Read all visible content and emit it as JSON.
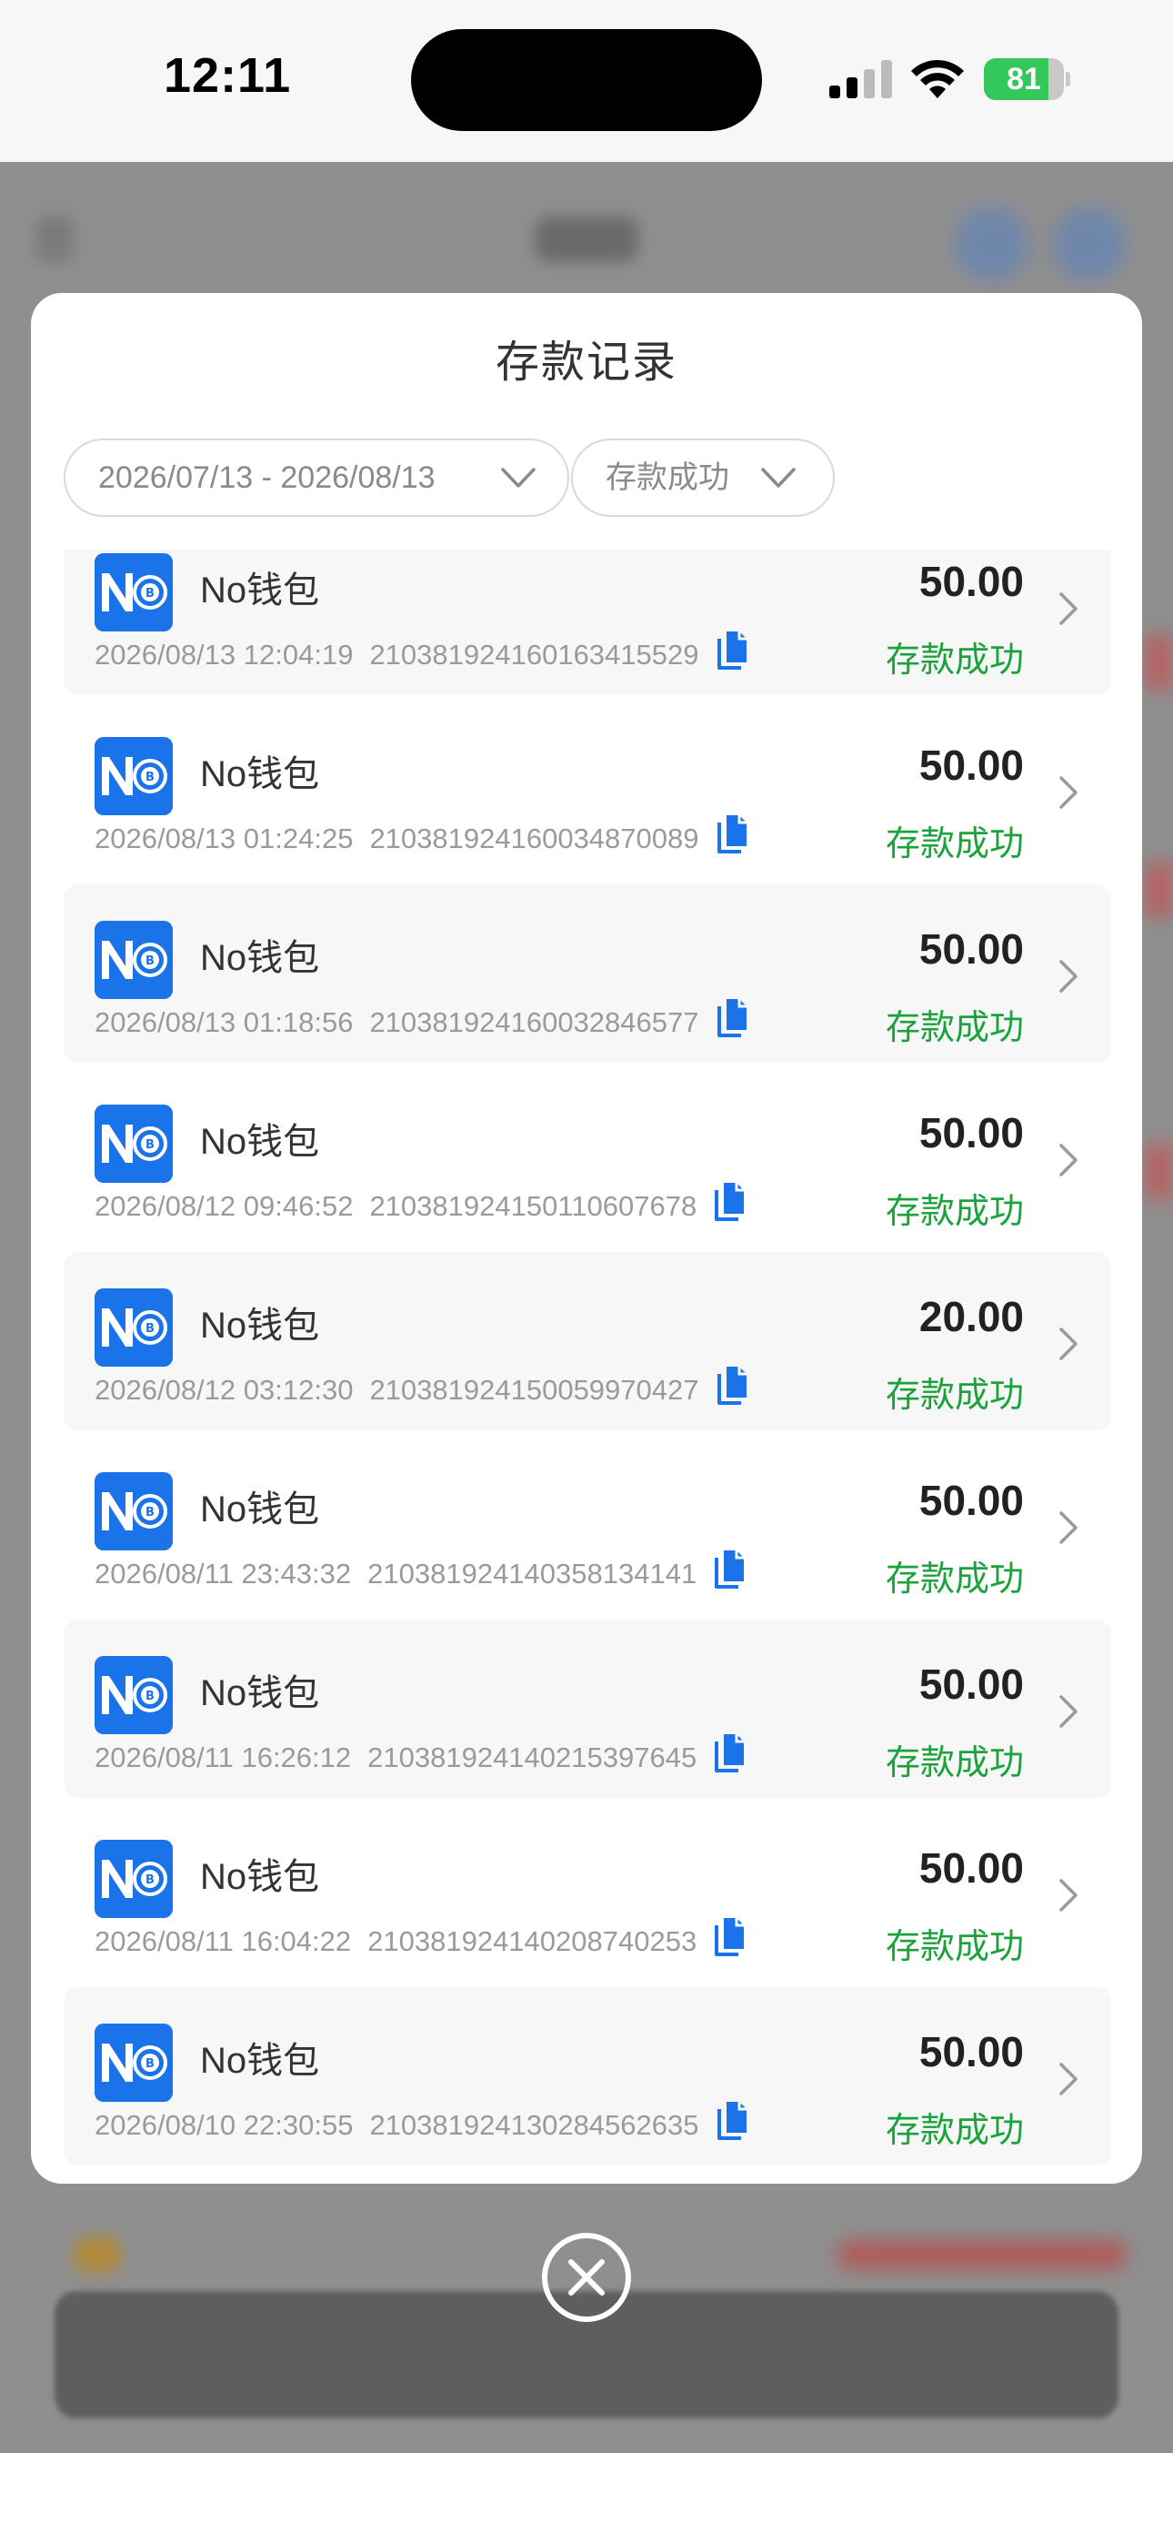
{
  "status_bar": {
    "time": "12:11",
    "battery_level": 81,
    "battery_text": "81"
  },
  "modal": {
    "title": "存款记录",
    "date_filter": "2026/07/13 - 2026/08/13",
    "status_filter": "存款成功",
    "records": [
      {
        "wallet": "No钱包",
        "datetime": "2026/08/13 12:04:19",
        "txid": "210381924160163415529",
        "amount": "50.00",
        "status": "存款成功"
      },
      {
        "wallet": "No钱包",
        "datetime": "2026/08/13 01:24:25",
        "txid": "210381924160034870089",
        "amount": "50.00",
        "status": "存款成功"
      },
      {
        "wallet": "No钱包",
        "datetime": "2026/08/13 01:18:56",
        "txid": "210381924160032846577",
        "amount": "50.00",
        "status": "存款成功"
      },
      {
        "wallet": "No钱包",
        "datetime": "2026/08/12 09:46:52",
        "txid": "210381924150110607678",
        "amount": "50.00",
        "status": "存款成功"
      },
      {
        "wallet": "No钱包",
        "datetime": "2026/08/12 03:12:30",
        "txid": "210381924150059970427",
        "amount": "20.00",
        "status": "存款成功"
      },
      {
        "wallet": "No钱包",
        "datetime": "2026/08/11 23:43:32",
        "txid": "210381924140358134141",
        "amount": "50.00",
        "status": "存款成功"
      },
      {
        "wallet": "No钱包",
        "datetime": "2026/08/11 16:26:12",
        "txid": "210381924140215397645",
        "amount": "50.00",
        "status": "存款成功"
      },
      {
        "wallet": "No钱包",
        "datetime": "2026/08/11 16:04:22",
        "txid": "210381924140208740253",
        "amount": "50.00",
        "status": "存款成功"
      },
      {
        "wallet": "No钱包",
        "datetime": "2026/08/10 22:30:55",
        "txid": "210381924130284562635",
        "amount": "50.00",
        "status": "存款成功"
      }
    ]
  },
  "colors": {
    "accent_blue": "#1a73e8",
    "success_green": "#1aa33a",
    "battery_green": "#34c759"
  },
  "icons": {
    "copy": "copy-icon",
    "chevron_right": "chevron-right-icon",
    "chevron_down": "chevron-down-icon",
    "close": "close-icon"
  }
}
